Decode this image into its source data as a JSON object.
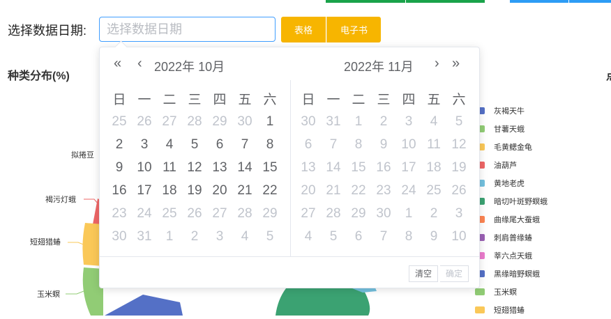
{
  "filter": {
    "label": "选择数据日期:",
    "placeholder": "选择数据日期",
    "buttons": {
      "table": "表格",
      "ebook": "电子书"
    }
  },
  "section": {
    "title": "种类分布(%)",
    "right_title_partial": "点"
  },
  "colors": {
    "accent": "#f7b500",
    "focus": "#409eff",
    "muted": "#c0c4cc"
  },
  "slice_labels": [
    "拟捲豆",
    "褐污灯蛾",
    "短翅猎蝽",
    "玉米螟"
  ],
  "legend": [
    {
      "name": "灰褐天牛",
      "color": "#5470c6"
    },
    {
      "name": "甘薯天蛾",
      "color": "#91cc75"
    },
    {
      "name": "毛黄鳃金龟",
      "color": "#fac858"
    },
    {
      "name": "油葫芦",
      "color": "#ee6666"
    },
    {
      "name": "黄地老虎",
      "color": "#73c0de"
    },
    {
      "name": "暗切叶斑野螟蛾",
      "color": "#3ba272"
    },
    {
      "name": "曲缘尾大蚕蛾",
      "color": "#fc8452"
    },
    {
      "name": "刺肩普缘蝽",
      "color": "#9a60b4"
    },
    {
      "name": "莘六点天蛾",
      "color": "#ea7ccc"
    },
    {
      "name": "黑缘暗野螟蛾",
      "color": "#5470c6"
    },
    {
      "name": "玉米螟",
      "color": "#91cc75"
    },
    {
      "name": "短翅猎蝽",
      "color": "#fac858"
    }
  ],
  "picker": {
    "nav": {
      "prev_year": "«",
      "prev_month": "‹",
      "next_month": "›",
      "next_year": "»"
    },
    "left": {
      "year": "2022年",
      "month": "10月"
    },
    "right": {
      "year": "2022年",
      "month": "11月"
    },
    "weekdays": [
      "日",
      "一",
      "二",
      "三",
      "四",
      "五",
      "六"
    ],
    "left_weeks": [
      [
        {
          "d": "25",
          "m": "other"
        },
        {
          "d": "26",
          "m": "other"
        },
        {
          "d": "27",
          "m": "other"
        },
        {
          "d": "28",
          "m": "other"
        },
        {
          "d": "29",
          "m": "other"
        },
        {
          "d": "30",
          "m": "other"
        },
        {
          "d": "1",
          "m": "current"
        }
      ],
      [
        {
          "d": "2",
          "m": "current"
        },
        {
          "d": "3",
          "m": "current"
        },
        {
          "d": "4",
          "m": "current"
        },
        {
          "d": "5",
          "m": "current"
        },
        {
          "d": "6",
          "m": "current"
        },
        {
          "d": "7",
          "m": "current"
        },
        {
          "d": "8",
          "m": "current"
        }
      ],
      [
        {
          "d": "9",
          "m": "current"
        },
        {
          "d": "10",
          "m": "current"
        },
        {
          "d": "11",
          "m": "current"
        },
        {
          "d": "12",
          "m": "current"
        },
        {
          "d": "13",
          "m": "current"
        },
        {
          "d": "14",
          "m": "current"
        },
        {
          "d": "15",
          "m": "current"
        }
      ],
      [
        {
          "d": "16",
          "m": "current"
        },
        {
          "d": "17",
          "m": "current"
        },
        {
          "d": "18",
          "m": "current"
        },
        {
          "d": "19",
          "m": "current"
        },
        {
          "d": "20",
          "m": "current"
        },
        {
          "d": "21",
          "m": "current"
        },
        {
          "d": "22",
          "m": "current"
        }
      ],
      [
        {
          "d": "23",
          "m": "other"
        },
        {
          "d": "24",
          "m": "other"
        },
        {
          "d": "25",
          "m": "other"
        },
        {
          "d": "26",
          "m": "other"
        },
        {
          "d": "27",
          "m": "other"
        },
        {
          "d": "28",
          "m": "other"
        },
        {
          "d": "29",
          "m": "other"
        }
      ],
      [
        {
          "d": "30",
          "m": "other"
        },
        {
          "d": "31",
          "m": "other"
        },
        {
          "d": "1",
          "m": "other"
        },
        {
          "d": "2",
          "m": "other"
        },
        {
          "d": "3",
          "m": "other"
        },
        {
          "d": "4",
          "m": "other"
        },
        {
          "d": "5",
          "m": "other"
        }
      ]
    ],
    "right_weeks": [
      [
        {
          "d": "30",
          "m": "other"
        },
        {
          "d": "31",
          "m": "other"
        },
        {
          "d": "1",
          "m": "other"
        },
        {
          "d": "2",
          "m": "other"
        },
        {
          "d": "3",
          "m": "other"
        },
        {
          "d": "4",
          "m": "other"
        },
        {
          "d": "5",
          "m": "other"
        }
      ],
      [
        {
          "d": "6",
          "m": "other"
        },
        {
          "d": "7",
          "m": "other"
        },
        {
          "d": "8",
          "m": "other"
        },
        {
          "d": "9",
          "m": "other"
        },
        {
          "d": "10",
          "m": "other"
        },
        {
          "d": "11",
          "m": "other"
        },
        {
          "d": "12",
          "m": "other"
        }
      ],
      [
        {
          "d": "13",
          "m": "other"
        },
        {
          "d": "14",
          "m": "other"
        },
        {
          "d": "15",
          "m": "other"
        },
        {
          "d": "16",
          "m": "other"
        },
        {
          "d": "17",
          "m": "other"
        },
        {
          "d": "18",
          "m": "other"
        },
        {
          "d": "19",
          "m": "other"
        }
      ],
      [
        {
          "d": "20",
          "m": "other"
        },
        {
          "d": "21",
          "m": "other"
        },
        {
          "d": "22",
          "m": "other"
        },
        {
          "d": "23",
          "m": "other"
        },
        {
          "d": "24",
          "m": "other"
        },
        {
          "d": "25",
          "m": "other"
        },
        {
          "d": "26",
          "m": "other"
        }
      ],
      [
        {
          "d": "27",
          "m": "other"
        },
        {
          "d": "28",
          "m": "other"
        },
        {
          "d": "29",
          "m": "other"
        },
        {
          "d": "30",
          "m": "other"
        },
        {
          "d": "1",
          "m": "other"
        },
        {
          "d": "2",
          "m": "other"
        },
        {
          "d": "3",
          "m": "other"
        }
      ],
      [
        {
          "d": "4",
          "m": "other"
        },
        {
          "d": "5",
          "m": "other"
        },
        {
          "d": "6",
          "m": "other"
        },
        {
          "d": "7",
          "m": "other"
        },
        {
          "d": "8",
          "m": "other"
        },
        {
          "d": "9",
          "m": "other"
        },
        {
          "d": "10",
          "m": "other"
        }
      ]
    ],
    "footer": {
      "clear": "清空",
      "confirm": "确定"
    }
  }
}
